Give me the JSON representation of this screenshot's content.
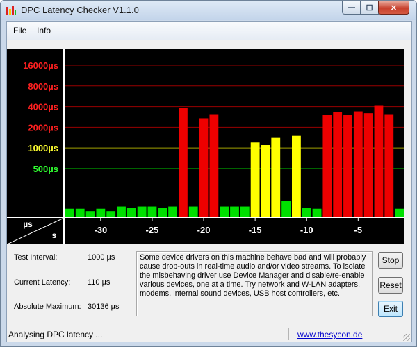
{
  "window": {
    "title": "DPC Latency Checker V1.1.0"
  },
  "menu": {
    "items": [
      "File",
      "Info"
    ]
  },
  "chart_data": {
    "type": "bar",
    "yscale": "log",
    "x": [
      -33,
      -32,
      -31,
      -30,
      -29,
      -28,
      -27,
      -26,
      -25,
      -24,
      -23,
      -22,
      -21,
      -20,
      -19,
      -18,
      -17,
      -16,
      -15,
      -14,
      -13,
      -12,
      -11,
      -10,
      -9,
      -8,
      -7,
      -6,
      -5,
      -4,
      -3,
      -2,
      -1
    ],
    "values": [
      130,
      130,
      120,
      130,
      120,
      140,
      135,
      140,
      140,
      135,
      140,
      3800,
      140,
      2700,
      3100,
      140,
      140,
      140,
      1200,
      1100,
      1400,
      170,
      1500,
      135,
      130,
      3000,
      3300,
      3000,
      3400,
      3200,
      4100,
      3100,
      130
    ],
    "colors": [
      "#00e000",
      "#00e000",
      "#00e000",
      "#00e000",
      "#00e000",
      "#00e000",
      "#00e000",
      "#00e000",
      "#00e000",
      "#00e000",
      "#00e000",
      "#ee0000",
      "#00e000",
      "#ee0000",
      "#ee0000",
      "#00e000",
      "#00e000",
      "#00e000",
      "#ffff00",
      "#ffff00",
      "#ffff00",
      "#00e000",
      "#ffff00",
      "#00e000",
      "#00e000",
      "#ee0000",
      "#ee0000",
      "#ee0000",
      "#ee0000",
      "#ee0000",
      "#ee0000",
      "#ee0000",
      "#00e000"
    ],
    "y_ticks": [
      {
        "value": 16000,
        "label": "16000µs",
        "color": "#ff2020",
        "line": "#990000"
      },
      {
        "value": 8000,
        "label": "8000µs",
        "color": "#ff2020",
        "line": "#990000"
      },
      {
        "value": 4000,
        "label": "4000µs",
        "color": "#ff2020",
        "line": "#990000"
      },
      {
        "value": 2000,
        "label": "2000µs",
        "color": "#ff2020",
        "line": "#990000"
      },
      {
        "value": 1000,
        "label": "1000µs",
        "color": "#ffff30",
        "line": "#a0a000"
      },
      {
        "value": 500,
        "label": "500µs",
        "color": "#30ff30",
        "line": "#00a000"
      }
    ],
    "x_ticks": [
      -30,
      -25,
      -20,
      -15,
      -10,
      -5
    ],
    "x_tick_labels": [
      "-30",
      "-25",
      "-20",
      "-15",
      "-10",
      "-5"
    ],
    "ylabel": "µs",
    "xlabel": "s",
    "xlim": [
      -33.5,
      -0.5
    ],
    "ylim": [
      100,
      28000
    ],
    "grid": true,
    "legend": "none"
  },
  "info": {
    "test_interval_label": "Test Interval:",
    "test_interval_value": "1000 µs",
    "current_latency_label": "Current Latency:",
    "current_latency_value": "110 µs",
    "absolute_max_label": "Absolute Maximum:",
    "absolute_max_value": "30136 µs"
  },
  "description": "Some device drivers on this machine behave bad and will probably cause drop-outs in real-time audio and/or video streams. To isolate the misbehaving driver use Device Manager and disable/re-enable various devices, one at a time. Try network and W-LAN adapters, modems, internal sound devices, USB host controllers, etc.",
  "buttons": {
    "stop": "Stop",
    "reset": "Reset",
    "exit": "Exit"
  },
  "status": {
    "text": "Analysing DPC latency ...",
    "link": "www.thesycon.de"
  },
  "colors": {
    "plot_bg": "#000000",
    "ok": "#00e000",
    "warn": "#ffff00",
    "bad": "#ee0000"
  }
}
